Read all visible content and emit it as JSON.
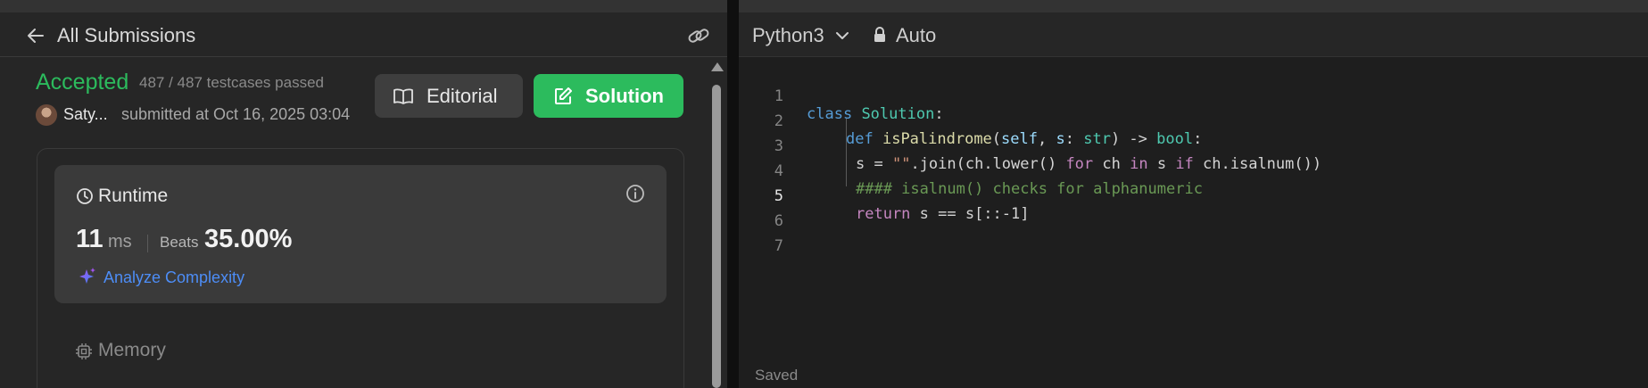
{
  "left": {
    "back_label": "All Submissions",
    "status": "Accepted",
    "testcases": "487 / 487 testcases passed",
    "user_name": "Saty...",
    "submitted": "submitted at Oct 16, 2025 03:04",
    "editorial_label": "Editorial",
    "solution_label": "Solution",
    "runtime": {
      "label": "Runtime",
      "value": "11",
      "unit": "ms",
      "beats_label": "Beats",
      "beats_value": "35.00%",
      "analyze_label": "Analyze Complexity"
    },
    "memory": {
      "label": "Memory"
    }
  },
  "editor": {
    "language": "Python3",
    "mode": "Auto",
    "saved": "Saved",
    "lines": [
      {
        "n": "1"
      },
      {
        "n": "2"
      },
      {
        "n": "3"
      },
      {
        "n": "4"
      },
      {
        "n": "5"
      },
      {
        "n": "6"
      },
      {
        "n": "7"
      }
    ],
    "code": {
      "l1": [
        "class",
        "Solution",
        ":"
      ],
      "l2": [
        "def",
        "isPalindrome",
        "(",
        "self",
        ", ",
        "s",
        ": ",
        "str",
        ") -> ",
        "bool",
        ":"
      ],
      "l3": [
        "s = ",
        "\"\"",
        ".join(ch.lower() ",
        "for",
        " ch ",
        "in",
        " s ",
        "if",
        " ch.isalnum())"
      ],
      "l4": [
        "#### isalnum() checks for alphanumeric"
      ],
      "l5": [
        "return",
        " s == s[::-1]"
      ]
    }
  },
  "colors": {
    "accepted": "#2cbb5d",
    "solution_button": "#2cbb5d",
    "link_blue": "#4d8df6",
    "sparkle_purple": "#a855f7"
  },
  "icons": {
    "back": "arrow-left-icon",
    "link": "link-icon",
    "editorial": "book-icon",
    "solution": "edit-icon",
    "runtime": "clock-icon",
    "info": "info-icon",
    "analyze": "sparkle-icon",
    "memory": "chip-icon",
    "language": "chevron-down-icon",
    "mode": "lock-icon"
  }
}
